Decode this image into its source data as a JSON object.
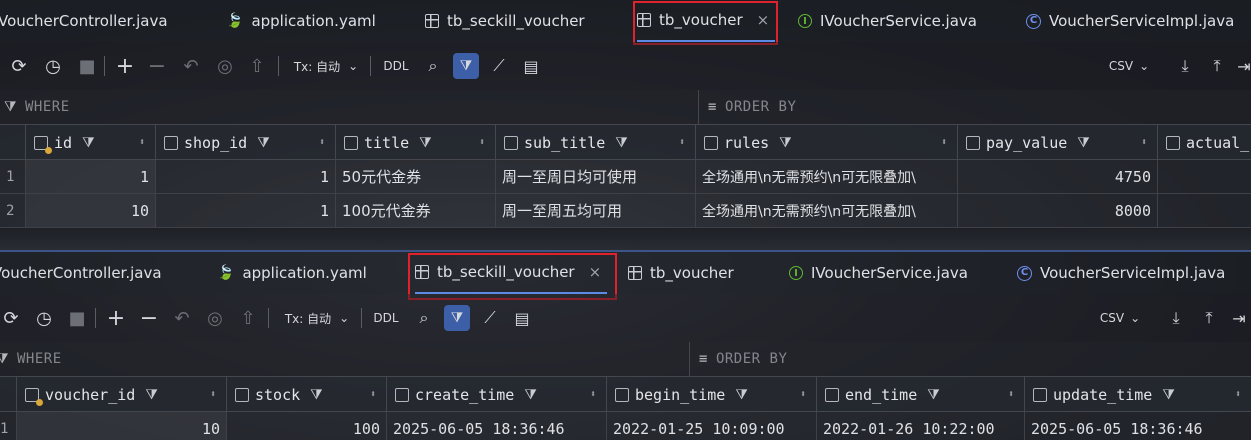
{
  "panel1": {
    "tabs": [
      {
        "label": "VoucherController.java",
        "icon": "java-file-icon",
        "active": false
      },
      {
        "label": "application.yaml",
        "icon": "yaml-file-icon",
        "active": false
      },
      {
        "label": "tb_seckill_voucher",
        "icon": "table-icon",
        "active": false
      },
      {
        "label": "tb_voucher",
        "icon": "table-icon",
        "active": true
      },
      {
        "label": "IVoucherService.java",
        "icon": "interface-icon",
        "active": false
      },
      {
        "label": "VoucherServiceImpl.java",
        "icon": "class-icon",
        "active": false
      }
    ],
    "close_glyph": "×",
    "toolbar": {
      "tx_label": "Tx: 自动",
      "ddl_label": "DDL",
      "csv_label": "CSV"
    },
    "filter": {
      "where": "WHERE",
      "order_by": "ORDER BY"
    },
    "columns": [
      "id",
      "shop_id",
      "title",
      "sub_title",
      "rules",
      "pay_value",
      "actual_"
    ],
    "rows": [
      {
        "row_num": "1",
        "id": "1",
        "shop_id": "1",
        "title": "50元代金券",
        "sub_title": "周一至周日均可使用",
        "rules": "全场通用\\n无需预约\\n可无限叠加\\",
        "pay_value": "4750"
      },
      {
        "row_num": "2",
        "id": "10",
        "shop_id": "1",
        "title": "100元代金券",
        "sub_title": "周一至周五均可用",
        "rules": "全场通用\\n无需预约\\n可无限叠加\\",
        "pay_value": "8000"
      }
    ]
  },
  "panel2": {
    "tabs": [
      {
        "label": "VoucherController.java",
        "icon": "java-file-icon",
        "active": false
      },
      {
        "label": "application.yaml",
        "icon": "yaml-file-icon",
        "active": false
      },
      {
        "label": "tb_seckill_voucher",
        "icon": "table-icon",
        "active": true
      },
      {
        "label": "tb_voucher",
        "icon": "table-icon",
        "active": false
      },
      {
        "label": "IVoucherService.java",
        "icon": "interface-icon",
        "active": false
      },
      {
        "label": "VoucherServiceImpl.java",
        "icon": "class-icon",
        "active": false
      }
    ],
    "close_glyph": "×",
    "toolbar": {
      "tx_label": "Tx: 自动",
      "ddl_label": "DDL",
      "csv_label": "CSV"
    },
    "filter": {
      "where": "WHERE",
      "order_by": "ORDER BY"
    },
    "columns": [
      "voucher_id",
      "stock",
      "create_time",
      "begin_time",
      "end_time",
      "update_time"
    ],
    "rows": [
      {
        "row_num": "1",
        "voucher_id": "10",
        "stock": "100",
        "create_time": "2025-06-05 18:36:46",
        "begin_time": "2022-01-25 10:09:00",
        "end_time": "2022-01-26 10:22:00",
        "update_time": "2025-06-05 18:36:46"
      }
    ]
  },
  "colors": {
    "highlight_box": "#e0222c",
    "accent": "#5c8ae6"
  }
}
